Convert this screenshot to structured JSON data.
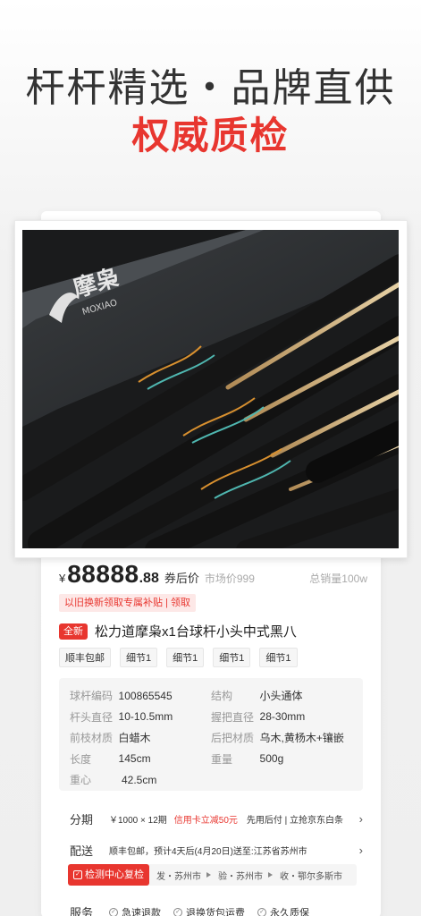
{
  "hero": {
    "title": "杆杆精选・品牌直供",
    "subtitle": "权威质检"
  },
  "product_image": {
    "brand_logo_cn": "摩枭",
    "brand_logo_en": "MOXIAO"
  },
  "price": {
    "currency": "¥",
    "integer": "88888",
    "decimal": ".88",
    "label": "券后价",
    "market_price": "市场价999",
    "total_sales": "总销量100w"
  },
  "promo": "以旧换新领取专属补贴 | 领取",
  "title": {
    "badge": "全新",
    "text": "松力道摩枭x1台球杆小头中式黑八"
  },
  "tags": [
    "顺丰包邮",
    "细节1",
    "细节1",
    "细节1",
    "细节1"
  ],
  "specs": [
    {
      "k1": "球杆编码",
      "v1": "100865545",
      "k2": "结构",
      "v2": "小头通体"
    },
    {
      "k1": "杆头直径",
      "v1": "10-10.5mm",
      "k2": "握把直径",
      "v2": "28-30mm"
    },
    {
      "k1": "前枝材质",
      "v1": "白蜡木",
      "k2": "后把材质",
      "v2": "乌木,黄杨木+镶嵌"
    },
    {
      "k1": "长度",
      "v1": "145cm",
      "k2": "重量",
      "v2": "500g"
    },
    {
      "k1": "重心",
      "v1": "42.5cm",
      "k2": "",
      "v2": ""
    }
  ],
  "installment": {
    "label": "分期",
    "plan": "￥1000 × 12期",
    "discount": "信用卡立减50元",
    "extra": "先用后付 | 立抢京东白条"
  },
  "shipping": {
    "label": "配送",
    "text": "顺丰包邮，预计4天后(4月20日)送至:江苏省苏州市"
  },
  "inspection": {
    "badge": "检测中心复检",
    "steps": [
      "发・苏州市",
      "验・苏州市",
      "收・鄂尔多斯市"
    ]
  },
  "service": {
    "label": "服务",
    "items": [
      "急速退款",
      "退换货包运费",
      "永久质保"
    ]
  },
  "colors": {
    "accent": "#e8362f",
    "text": "#333333",
    "muted": "#999999"
  }
}
